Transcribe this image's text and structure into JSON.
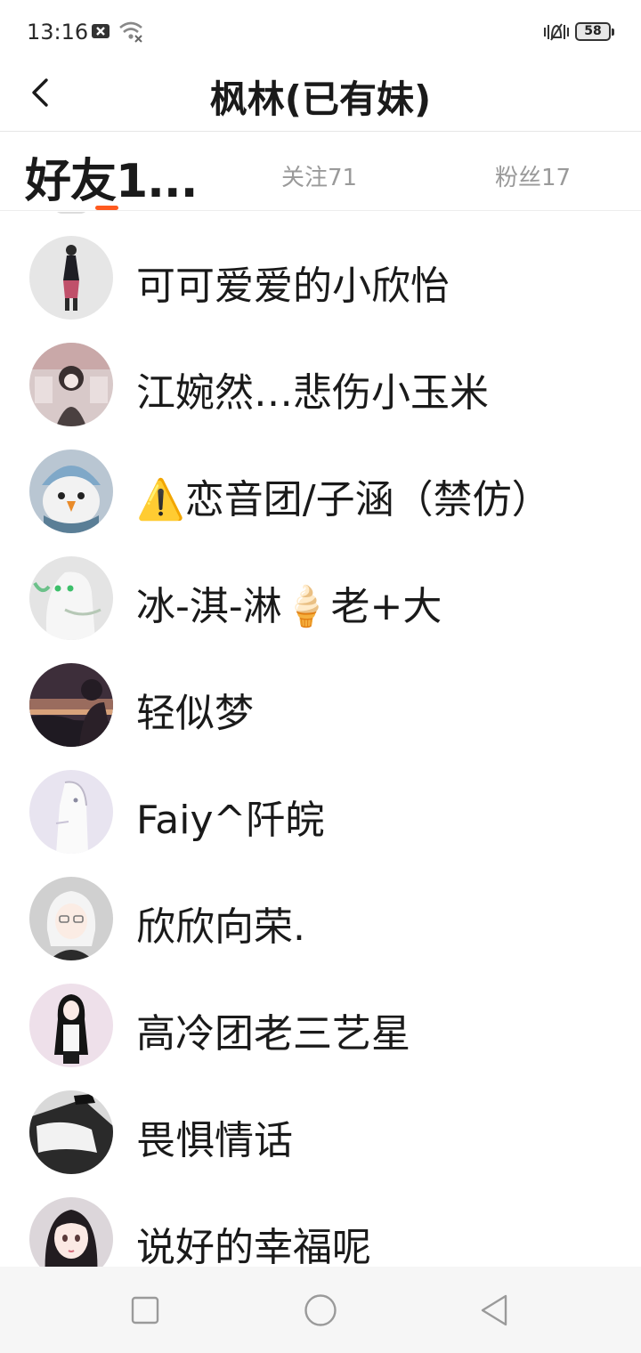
{
  "status_bar": {
    "time": "13:16",
    "battery": "58"
  },
  "header": {
    "title": "枫林(已有妹)"
  },
  "tabs": [
    {
      "label": "好友1..."
    },
    {
      "label": "关注71"
    },
    {
      "label": "粉丝17"
    }
  ],
  "accent_color": "#ff5a1f",
  "friends": [
    {
      "name": "可可爱爱的小欣怡"
    },
    {
      "name": "江婉然…悲伤小玉米"
    },
    {
      "name": "⚠️恋音团/子涵（禁仿）"
    },
    {
      "name": "冰-淇-淋🍦老+大"
    },
    {
      "name": "轻似梦"
    },
    {
      "name": "Faiy^阡皖"
    },
    {
      "name": "欣欣向荣."
    },
    {
      "name": "高冷团老三艺星"
    },
    {
      "name": "畏惧情话"
    },
    {
      "name": "说好的幸福呢"
    }
  ]
}
